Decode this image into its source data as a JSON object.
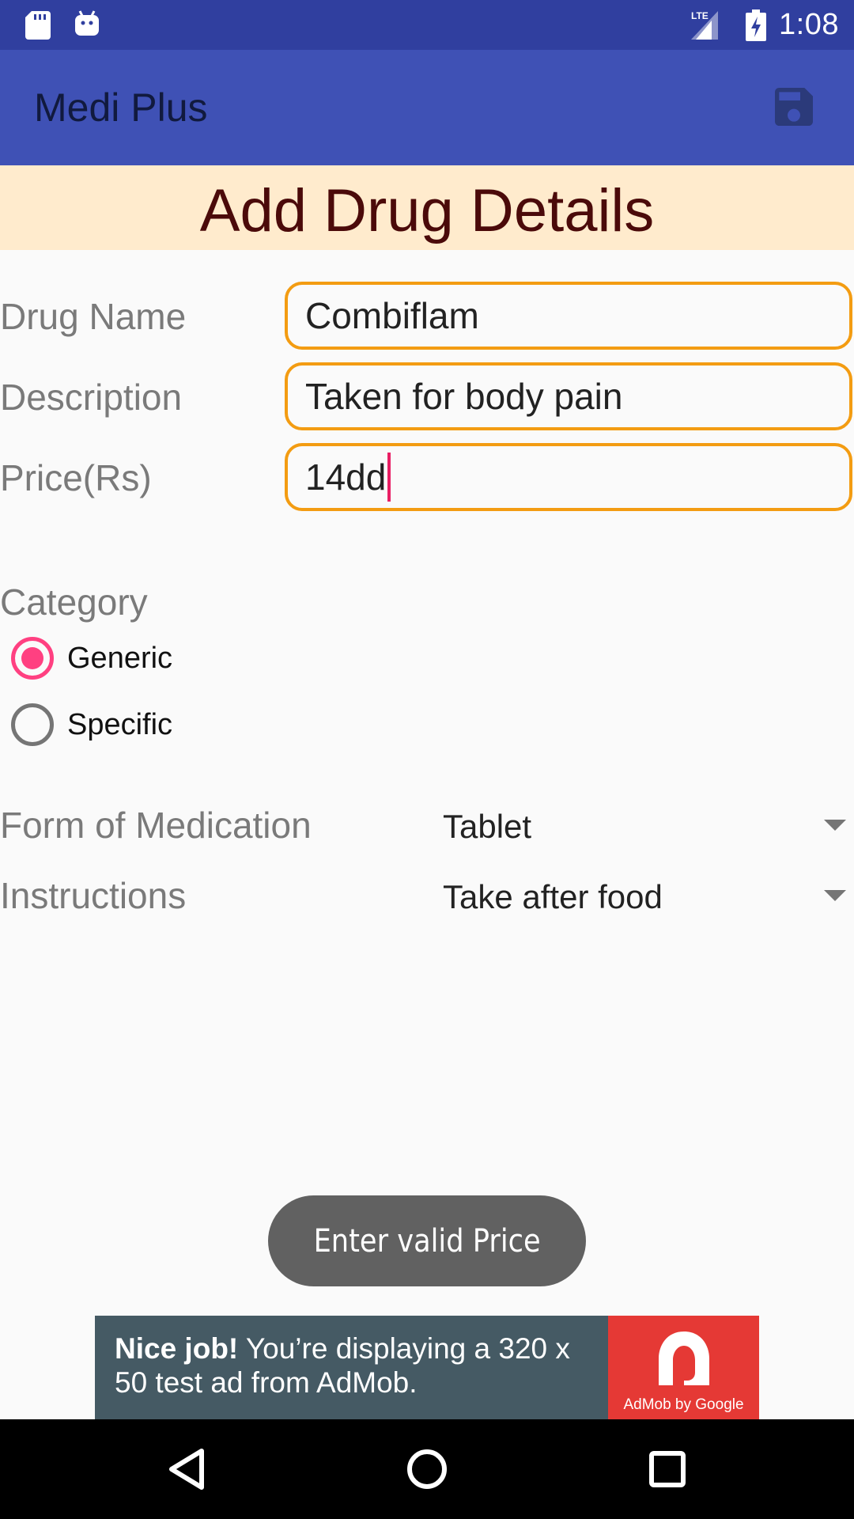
{
  "status_bar": {
    "time": "1:08",
    "network": "LTE",
    "icons": [
      "sd-card-icon",
      "android-debug-icon",
      "lte-signal-icon",
      "battery-charging-icon"
    ]
  },
  "app_bar": {
    "title": "Medi Plus",
    "action_icon": "save-icon",
    "color": "#3f51b5"
  },
  "heading": "Add Drug Details",
  "form": {
    "drug_name": {
      "label": "Drug Name",
      "value": "Combiflam"
    },
    "description": {
      "label": "Description",
      "value": "Taken for body pain"
    },
    "price": {
      "label": "Price(Rs)",
      "value": "14dd"
    }
  },
  "category": {
    "label": "Category",
    "options": [
      {
        "label": "Generic",
        "checked": true
      },
      {
        "label": "Specific",
        "checked": false
      }
    ]
  },
  "form_of_medication": {
    "label": "Form of Medication",
    "value": "Tablet"
  },
  "instructions": {
    "label": "Instructions",
    "value": "Take after food"
  },
  "toast": "Enter valid Price",
  "ad": {
    "bold": "Nice job!",
    "text": " You’re displaying a 320 x 50 test ad from AdMob.",
    "brand": "AdMob by Google"
  },
  "nav": {
    "icons": [
      "back-icon",
      "home-icon",
      "recents-icon"
    ]
  },
  "colors": {
    "field_border": "#f39c12",
    "accent": "#ff4081",
    "heading_band": "#ffebcd",
    "heading_text": "#4b0a0a"
  }
}
